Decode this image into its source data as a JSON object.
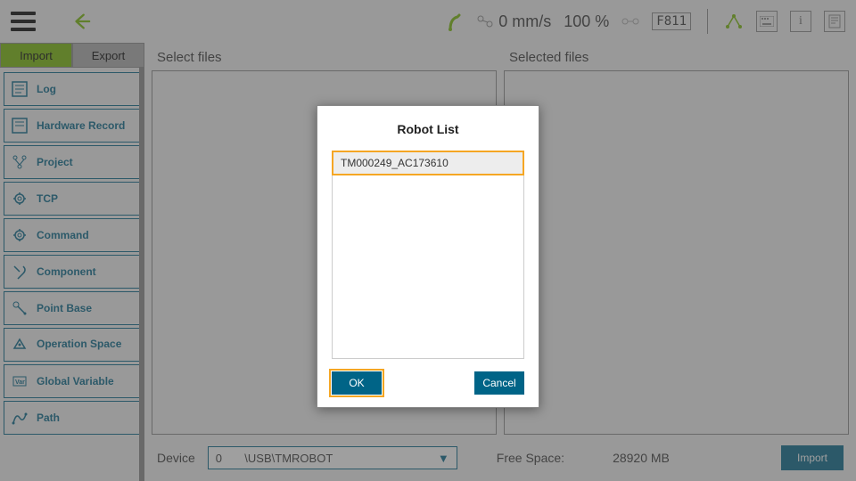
{
  "topbar": {
    "speed": "0 mm/s",
    "percent": "100 %",
    "code": "F811"
  },
  "sidebar": {
    "tabs": {
      "import": "Import",
      "export": "Export"
    },
    "items": [
      {
        "label": "Log"
      },
      {
        "label": "Hardware Record"
      },
      {
        "label": "Project"
      },
      {
        "label": "TCP"
      },
      {
        "label": "Command"
      },
      {
        "label": "Component"
      },
      {
        "label": "Point Base"
      },
      {
        "label": "Operation Space"
      },
      {
        "label": "Global Variable"
      },
      {
        "label": "Path"
      }
    ]
  },
  "panels": {
    "left_title": "Select files",
    "right_title": "Selected files"
  },
  "footer": {
    "device_label": "Device",
    "device_value": "0       \\USB\\TMROBOT",
    "free_space_label": "Free Space:",
    "free_space_value": "28920 MB",
    "import_btn": "Import"
  },
  "modal": {
    "title": "Robot List",
    "items": [
      "TM000249_AC173610"
    ],
    "ok": "OK",
    "cancel": "Cancel"
  }
}
